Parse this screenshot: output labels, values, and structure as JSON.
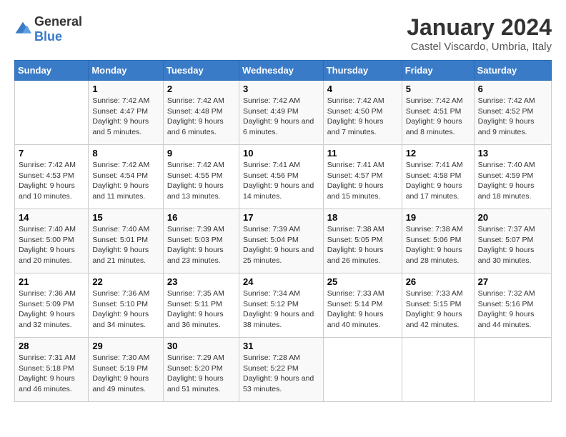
{
  "logo": {
    "general": "General",
    "blue": "Blue"
  },
  "header": {
    "month": "January 2024",
    "location": "Castel Viscardo, Umbria, Italy"
  },
  "weekdays": [
    "Sunday",
    "Monday",
    "Tuesday",
    "Wednesday",
    "Thursday",
    "Friday",
    "Saturday"
  ],
  "weeks": [
    [
      {
        "day": "",
        "sunrise": "",
        "sunset": "",
        "daylight": ""
      },
      {
        "day": "1",
        "sunrise": "Sunrise: 7:42 AM",
        "sunset": "Sunset: 4:47 PM",
        "daylight": "Daylight: 9 hours and 5 minutes."
      },
      {
        "day": "2",
        "sunrise": "Sunrise: 7:42 AM",
        "sunset": "Sunset: 4:48 PM",
        "daylight": "Daylight: 9 hours and 6 minutes."
      },
      {
        "day": "3",
        "sunrise": "Sunrise: 7:42 AM",
        "sunset": "Sunset: 4:49 PM",
        "daylight": "Daylight: 9 hours and 6 minutes."
      },
      {
        "day": "4",
        "sunrise": "Sunrise: 7:42 AM",
        "sunset": "Sunset: 4:50 PM",
        "daylight": "Daylight: 9 hours and 7 minutes."
      },
      {
        "day": "5",
        "sunrise": "Sunrise: 7:42 AM",
        "sunset": "Sunset: 4:51 PM",
        "daylight": "Daylight: 9 hours and 8 minutes."
      },
      {
        "day": "6",
        "sunrise": "Sunrise: 7:42 AM",
        "sunset": "Sunset: 4:52 PM",
        "daylight": "Daylight: 9 hours and 9 minutes."
      }
    ],
    [
      {
        "day": "7",
        "sunrise": "Sunrise: 7:42 AM",
        "sunset": "Sunset: 4:53 PM",
        "daylight": "Daylight: 9 hours and 10 minutes."
      },
      {
        "day": "8",
        "sunrise": "Sunrise: 7:42 AM",
        "sunset": "Sunset: 4:54 PM",
        "daylight": "Daylight: 9 hours and 11 minutes."
      },
      {
        "day": "9",
        "sunrise": "Sunrise: 7:42 AM",
        "sunset": "Sunset: 4:55 PM",
        "daylight": "Daylight: 9 hours and 13 minutes."
      },
      {
        "day": "10",
        "sunrise": "Sunrise: 7:41 AM",
        "sunset": "Sunset: 4:56 PM",
        "daylight": "Daylight: 9 hours and 14 minutes."
      },
      {
        "day": "11",
        "sunrise": "Sunrise: 7:41 AM",
        "sunset": "Sunset: 4:57 PM",
        "daylight": "Daylight: 9 hours and 15 minutes."
      },
      {
        "day": "12",
        "sunrise": "Sunrise: 7:41 AM",
        "sunset": "Sunset: 4:58 PM",
        "daylight": "Daylight: 9 hours and 17 minutes."
      },
      {
        "day": "13",
        "sunrise": "Sunrise: 7:40 AM",
        "sunset": "Sunset: 4:59 PM",
        "daylight": "Daylight: 9 hours and 18 minutes."
      }
    ],
    [
      {
        "day": "14",
        "sunrise": "Sunrise: 7:40 AM",
        "sunset": "Sunset: 5:00 PM",
        "daylight": "Daylight: 9 hours and 20 minutes."
      },
      {
        "day": "15",
        "sunrise": "Sunrise: 7:40 AM",
        "sunset": "Sunset: 5:01 PM",
        "daylight": "Daylight: 9 hours and 21 minutes."
      },
      {
        "day": "16",
        "sunrise": "Sunrise: 7:39 AM",
        "sunset": "Sunset: 5:03 PM",
        "daylight": "Daylight: 9 hours and 23 minutes."
      },
      {
        "day": "17",
        "sunrise": "Sunrise: 7:39 AM",
        "sunset": "Sunset: 5:04 PM",
        "daylight": "Daylight: 9 hours and 25 minutes."
      },
      {
        "day": "18",
        "sunrise": "Sunrise: 7:38 AM",
        "sunset": "Sunset: 5:05 PM",
        "daylight": "Daylight: 9 hours and 26 minutes."
      },
      {
        "day": "19",
        "sunrise": "Sunrise: 7:38 AM",
        "sunset": "Sunset: 5:06 PM",
        "daylight": "Daylight: 9 hours and 28 minutes."
      },
      {
        "day": "20",
        "sunrise": "Sunrise: 7:37 AM",
        "sunset": "Sunset: 5:07 PM",
        "daylight": "Daylight: 9 hours and 30 minutes."
      }
    ],
    [
      {
        "day": "21",
        "sunrise": "Sunrise: 7:36 AM",
        "sunset": "Sunset: 5:09 PM",
        "daylight": "Daylight: 9 hours and 32 minutes."
      },
      {
        "day": "22",
        "sunrise": "Sunrise: 7:36 AM",
        "sunset": "Sunset: 5:10 PM",
        "daylight": "Daylight: 9 hours and 34 minutes."
      },
      {
        "day": "23",
        "sunrise": "Sunrise: 7:35 AM",
        "sunset": "Sunset: 5:11 PM",
        "daylight": "Daylight: 9 hours and 36 minutes."
      },
      {
        "day": "24",
        "sunrise": "Sunrise: 7:34 AM",
        "sunset": "Sunset: 5:12 PM",
        "daylight": "Daylight: 9 hours and 38 minutes."
      },
      {
        "day": "25",
        "sunrise": "Sunrise: 7:33 AM",
        "sunset": "Sunset: 5:14 PM",
        "daylight": "Daylight: 9 hours and 40 minutes."
      },
      {
        "day": "26",
        "sunrise": "Sunrise: 7:33 AM",
        "sunset": "Sunset: 5:15 PM",
        "daylight": "Daylight: 9 hours and 42 minutes."
      },
      {
        "day": "27",
        "sunrise": "Sunrise: 7:32 AM",
        "sunset": "Sunset: 5:16 PM",
        "daylight": "Daylight: 9 hours and 44 minutes."
      }
    ],
    [
      {
        "day": "28",
        "sunrise": "Sunrise: 7:31 AM",
        "sunset": "Sunset: 5:18 PM",
        "daylight": "Daylight: 9 hours and 46 minutes."
      },
      {
        "day": "29",
        "sunrise": "Sunrise: 7:30 AM",
        "sunset": "Sunset: 5:19 PM",
        "daylight": "Daylight: 9 hours and 49 minutes."
      },
      {
        "day": "30",
        "sunrise": "Sunrise: 7:29 AM",
        "sunset": "Sunset: 5:20 PM",
        "daylight": "Daylight: 9 hours and 51 minutes."
      },
      {
        "day": "31",
        "sunrise": "Sunrise: 7:28 AM",
        "sunset": "Sunset: 5:22 PM",
        "daylight": "Daylight: 9 hours and 53 minutes."
      },
      {
        "day": "",
        "sunrise": "",
        "sunset": "",
        "daylight": ""
      },
      {
        "day": "",
        "sunrise": "",
        "sunset": "",
        "daylight": ""
      },
      {
        "day": "",
        "sunrise": "",
        "sunset": "",
        "daylight": ""
      }
    ]
  ]
}
